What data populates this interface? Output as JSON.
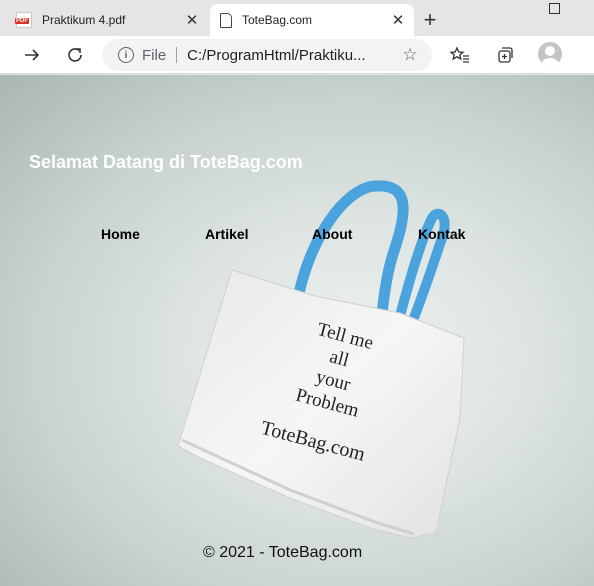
{
  "tabs": [
    {
      "label": "Praktikum 4.pdf",
      "active": false,
      "favicon": "pdf-icon"
    },
    {
      "label": "ToteBag.com",
      "active": true,
      "favicon": "page-icon"
    }
  ],
  "toolbar": {
    "scheme": "File",
    "url": "C:/ProgramHtml/Praktiku..."
  },
  "site": {
    "title": "Selamat Datang di ToteBag.com",
    "nav": [
      "Home",
      "Artikel",
      "About",
      "Kontak"
    ],
    "bag_text": [
      "Tell me",
      "all",
      "your",
      "Problem",
      "ToteBag.com"
    ],
    "footer": "© 2021 - ToteBag.com"
  },
  "colors": {
    "title_text": "#ffffff",
    "bag_handle": "#4aa3dc",
    "bag_body": "#f2f2f2",
    "page_bg": "#d4dcda"
  }
}
